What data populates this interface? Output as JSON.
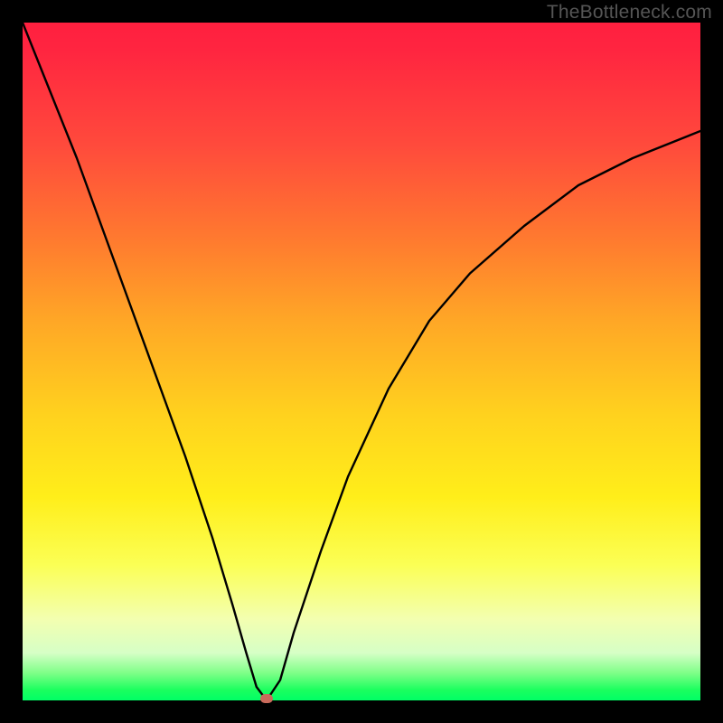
{
  "watermark": "TheBottleneck.com",
  "chart_data": {
    "type": "line",
    "title": "",
    "xlabel": "",
    "ylabel": "",
    "xlim": [
      0,
      100
    ],
    "ylim": [
      0,
      100
    ],
    "background_gradient": {
      "direction": "vertical",
      "stops": [
        {
          "pos": 0,
          "color": "#ff1f3f"
        },
        {
          "pos": 44,
          "color": "#ffa726"
        },
        {
          "pos": 70,
          "color": "#ffee1a"
        },
        {
          "pos": 93,
          "color": "#d6ffc6"
        },
        {
          "pos": 100,
          "color": "#00ff66"
        }
      ]
    },
    "series": [
      {
        "name": "bottleneck-curve",
        "x": [
          0,
          4,
          8,
          12,
          16,
          20,
          24,
          28,
          31,
          33,
          34.5,
          36,
          38,
          40,
          44,
          48,
          54,
          60,
          66,
          74,
          82,
          90,
          100
        ],
        "y": [
          100,
          90,
          80,
          69,
          58,
          47,
          36,
          24,
          14,
          7,
          2,
          0,
          3,
          10,
          22,
          33,
          46,
          56,
          63,
          70,
          76,
          80,
          84
        ]
      }
    ],
    "marker": {
      "name": "optimal-point",
      "x": 36,
      "y": 0.3,
      "color": "#c96a5b"
    },
    "grid": false,
    "legend": false
  }
}
